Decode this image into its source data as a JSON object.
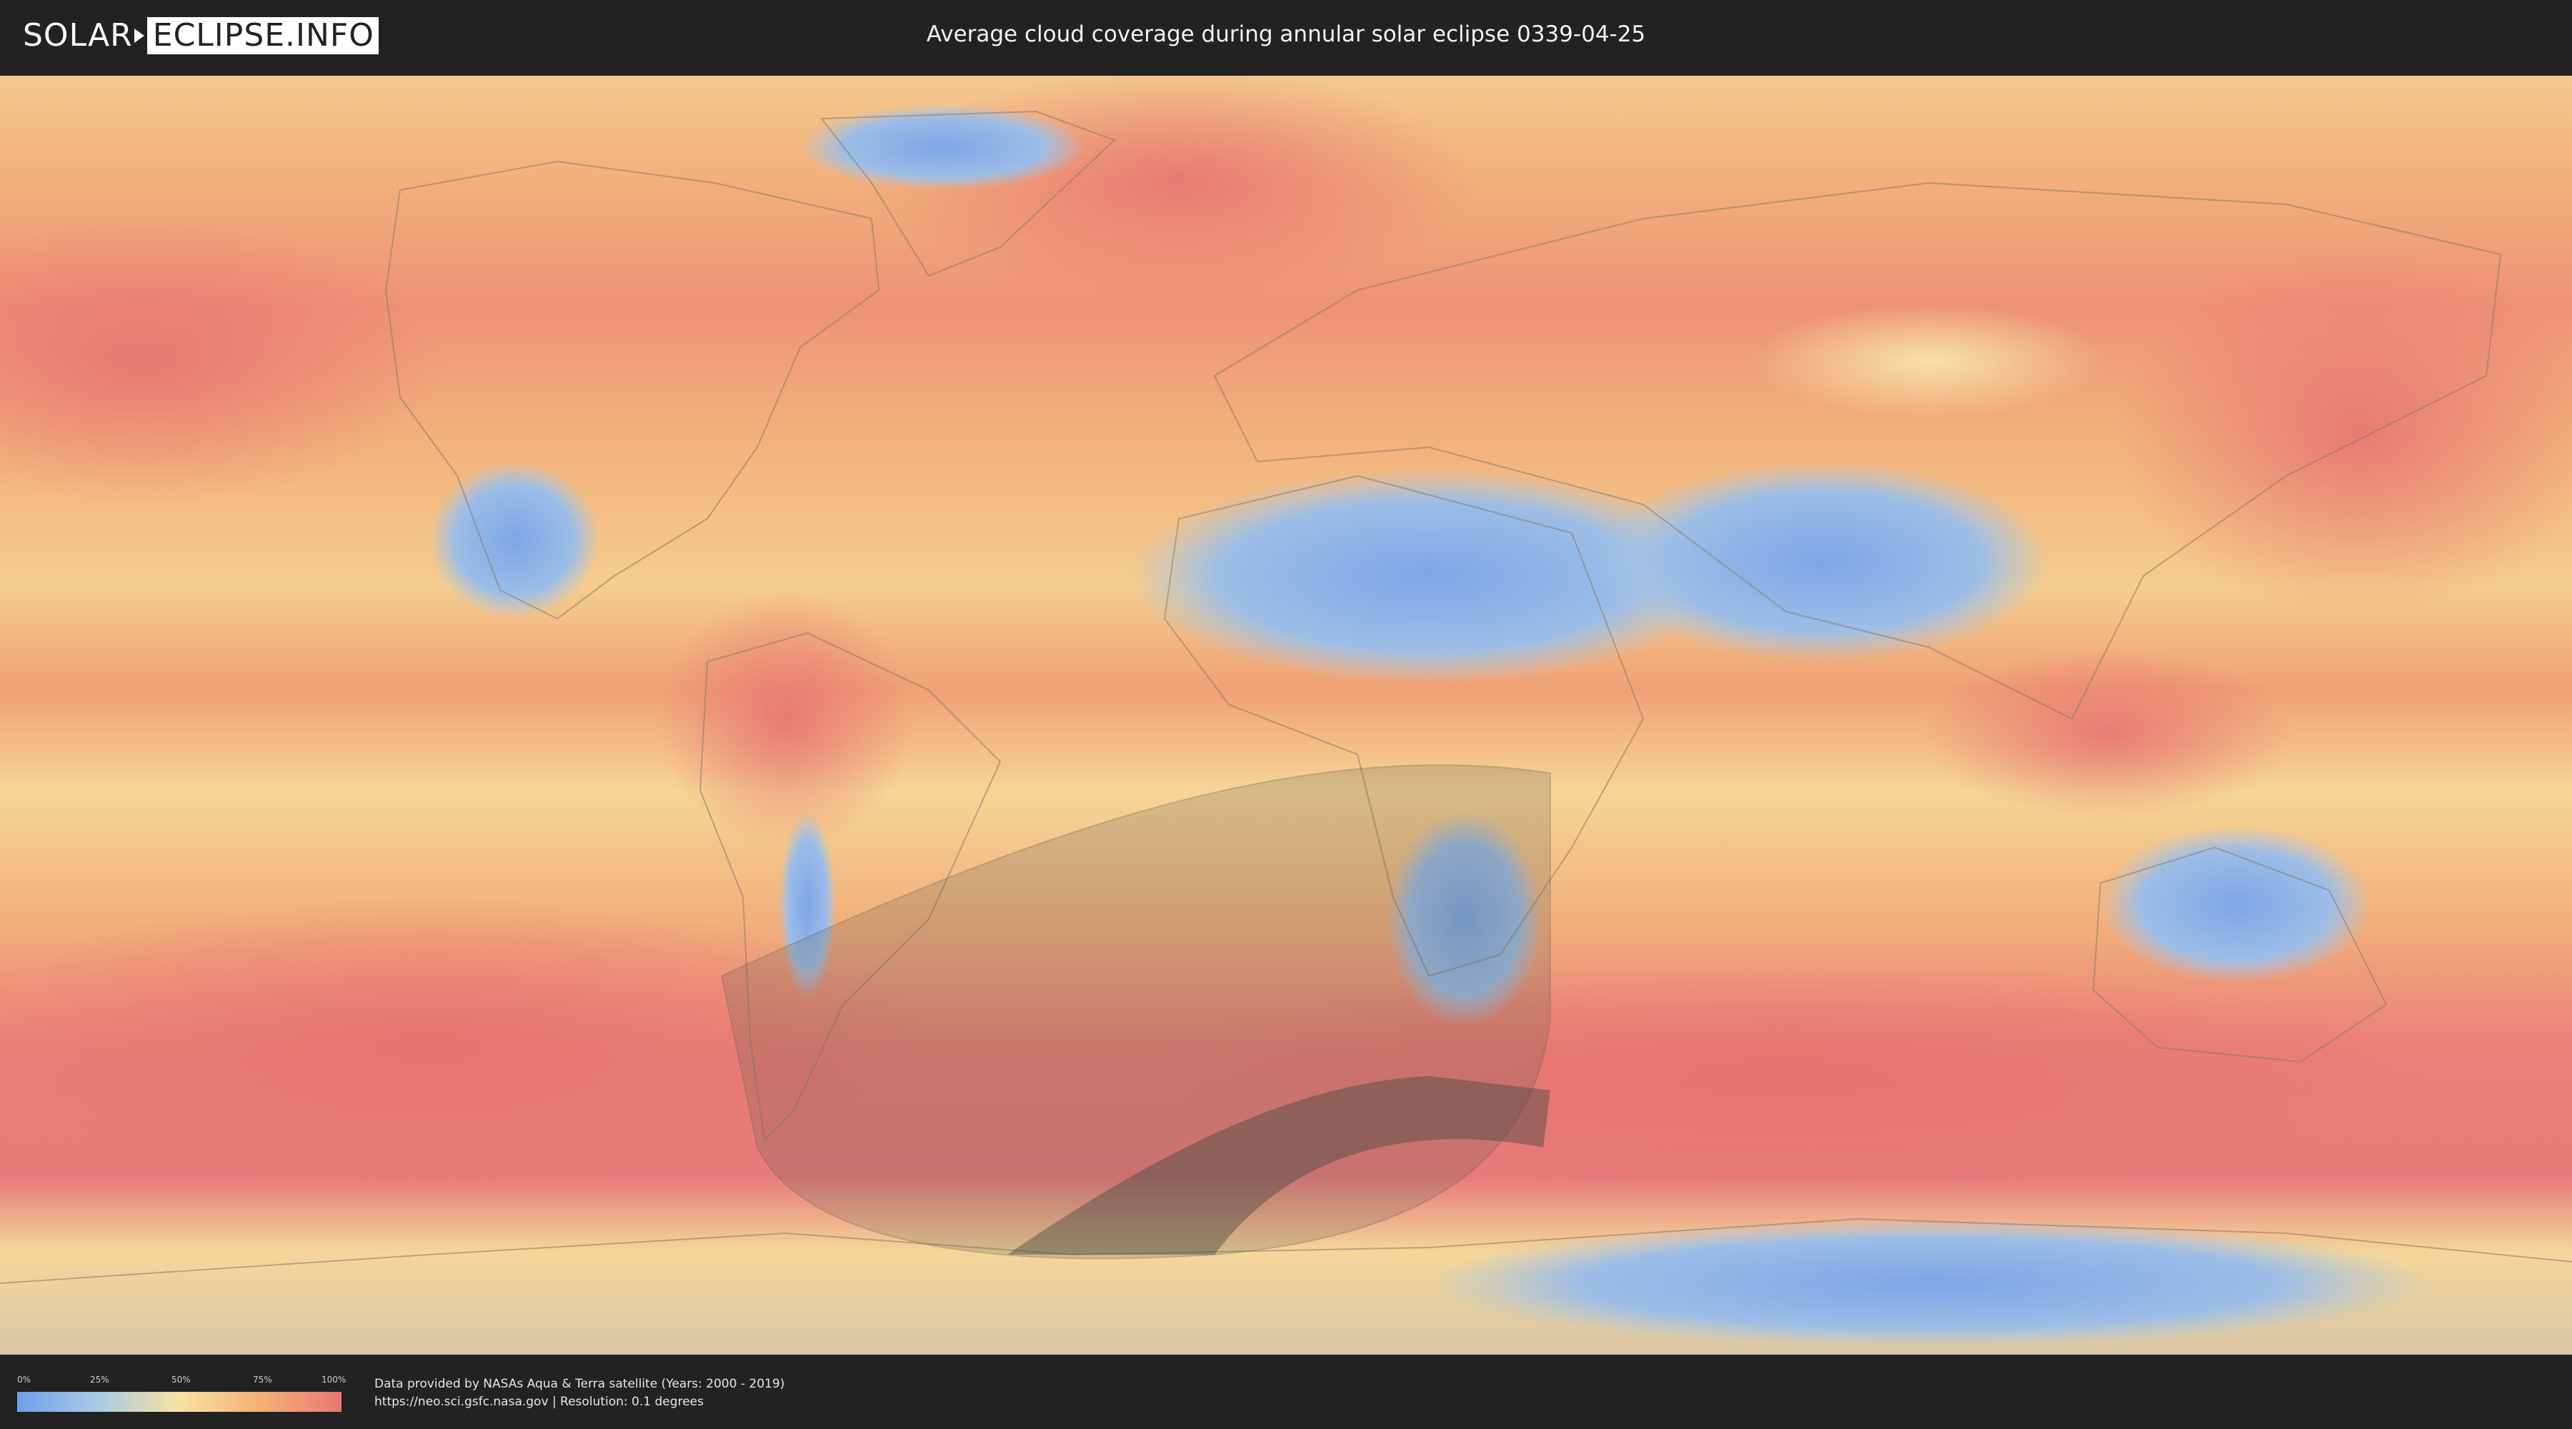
{
  "header": {
    "logo_left": "SOLAR",
    "logo_right": "ECLIPSE.INFO",
    "title": "Average cloud coverage during annular solar eclipse 0339-04-25"
  },
  "map": {
    "colors": {
      "ocean_cloudy": "#e8797a",
      "ocean_mid": "#f2a275",
      "land_mid": "#f5cd8e",
      "clear": "#7ea6e6",
      "light": "#a9c7e6",
      "outline": "#8b7a6a",
      "eclipse_shadow": "#5a5a4e"
    }
  },
  "legend": {
    "ticks": [
      "0%",
      "25%",
      "50%",
      "75%",
      "100%"
    ],
    "colors": [
      "#6fa0e8",
      "#a9cbe4",
      "#f6e2a2",
      "#f4b077",
      "#ea7773"
    ]
  },
  "footer": {
    "line1": "Data provided by NASAs Aqua & Terra satellite (Years: 2000 - 2019)",
    "line2": "https://neo.sci.gsfc.nasa.gov | Resolution: 0.1 degrees"
  }
}
